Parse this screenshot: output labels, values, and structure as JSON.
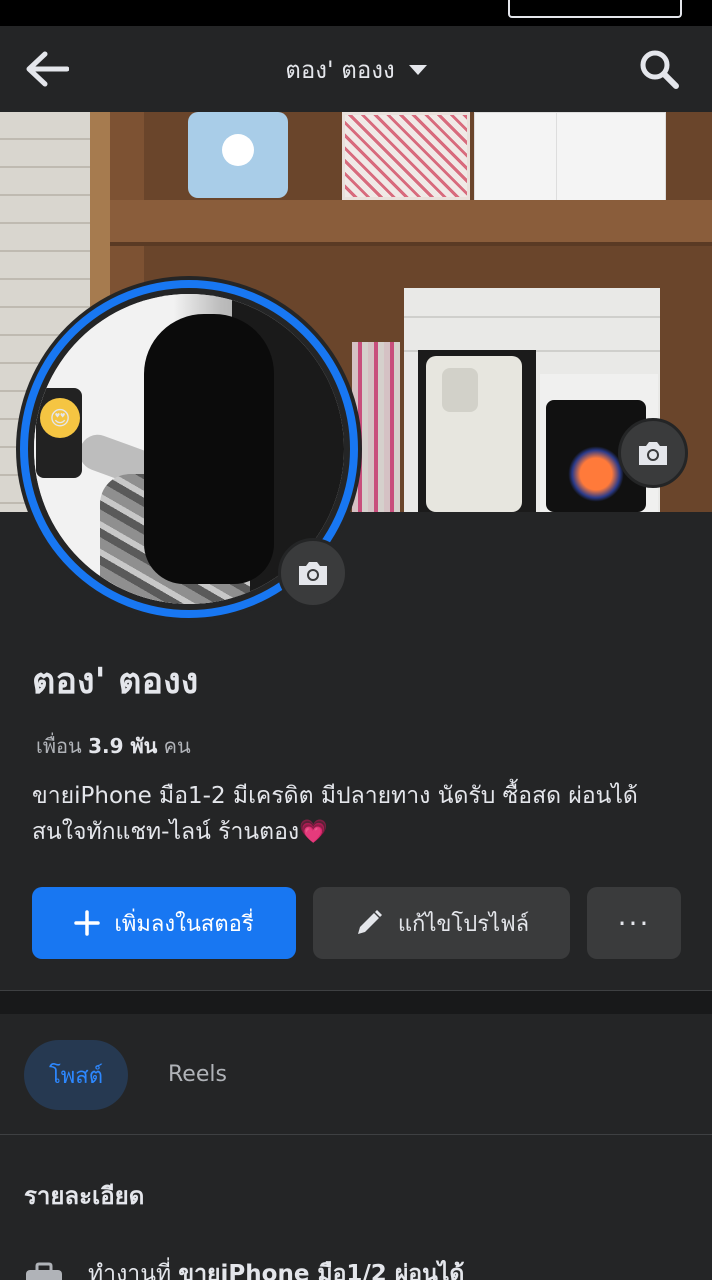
{
  "header": {
    "title": "ตอง' ตองง",
    "back_icon": "arrow-left-icon",
    "search_icon": "search-icon",
    "dropdown_icon": "caret-down-icon"
  },
  "profile": {
    "name": "ตอง' ตองง",
    "friends_label": "เพื่อน",
    "friends_count": "3.9 พัน",
    "friends_unit": "คน",
    "bio": "ขายiPhone มือ1-2 มีเครดิต มีปลายทาง นัดรับ ซื้อสด ผ่อนได้ สนใจทักแชท-ไลน์ ร้านตอง💗"
  },
  "buttons": {
    "add_story": "เพิ่มลงในสตอรี่",
    "edit_profile": "แก้ไขโปรไฟล์",
    "more": "···"
  },
  "tabs": [
    {
      "label": "โพสต์",
      "active": true
    },
    {
      "label": "Reels",
      "active": false
    }
  ],
  "details": {
    "title": "รายละเอียด",
    "work_prefix": "ทำงานที่",
    "work_place": "ขายiPhone มือ1/2 ผ่อนได้"
  },
  "colors": {
    "background": "#242526",
    "accent": "#1877f2",
    "secondary_button": "#3a3b3c",
    "active_tab_bg": "#263951",
    "active_tab_text": "#2d88ff"
  }
}
